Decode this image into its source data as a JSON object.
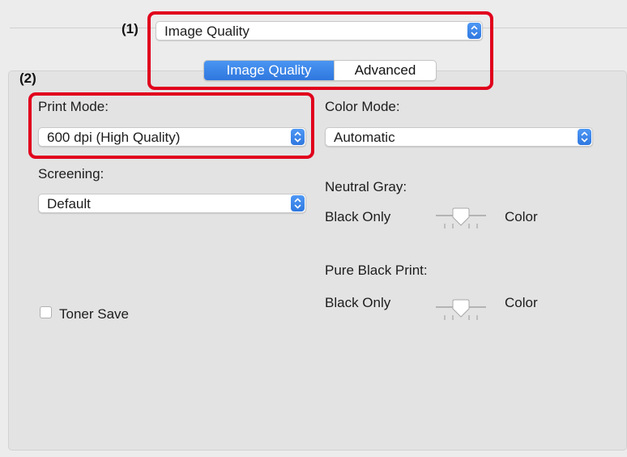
{
  "callouts": {
    "one": "(1)",
    "two": "(2)"
  },
  "header": {
    "panel_popup": {
      "value": "Image Quality"
    },
    "tabs": [
      {
        "label": "Image Quality",
        "selected": true
      },
      {
        "label": "Advanced",
        "selected": false
      }
    ]
  },
  "left": {
    "print_mode": {
      "label": "Print Mode:",
      "value": "600 dpi (High Quality)"
    },
    "screening": {
      "label": "Screening:",
      "value": "Default"
    },
    "toner_save": {
      "label": "Toner Save",
      "checked": false
    }
  },
  "right": {
    "color_mode": {
      "label": "Color Mode:",
      "value": "Automatic"
    },
    "neutral_gray": {
      "label": "Neutral Gray:",
      "min_label": "Black Only",
      "max_label": "Color",
      "position": 0.5
    },
    "pure_black_print": {
      "label": "Pure Black Print:",
      "min_label": "Black Only",
      "max_label": "Color",
      "position": 0.5
    }
  },
  "colors": {
    "accent": "#2f78e0",
    "highlight": "#e1001c",
    "panel": "#e3e3e3"
  }
}
